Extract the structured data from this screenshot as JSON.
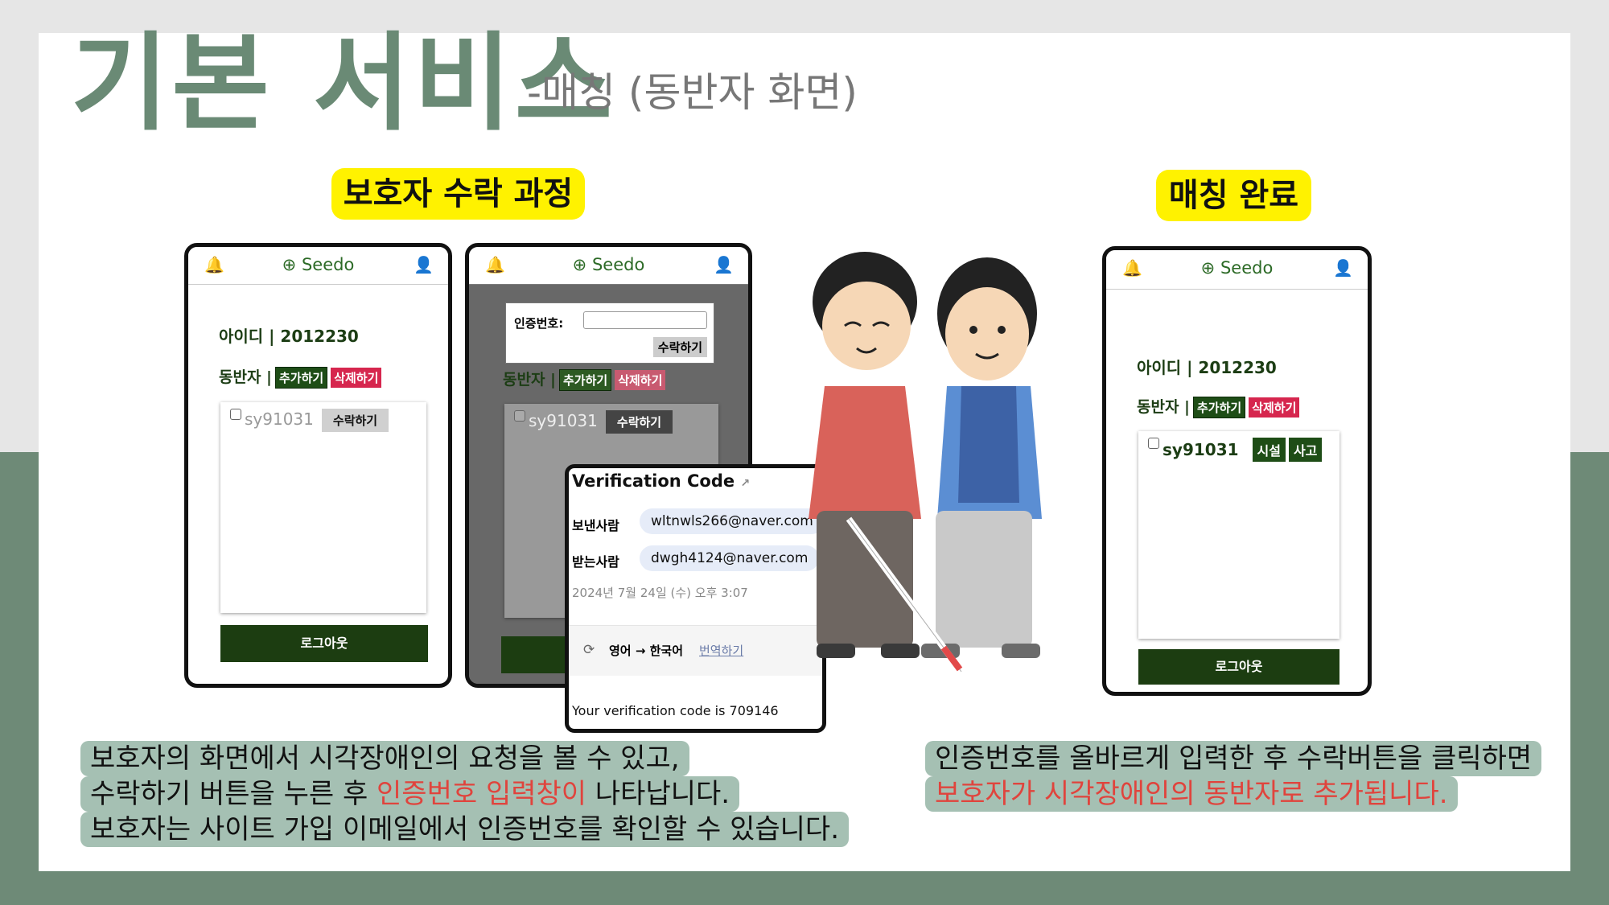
{
  "title": "기본 서비스",
  "subtitle": "-매칭 (동반자 화면)",
  "label_left": "보호자 수락 과정",
  "label_right": "매칭 완료",
  "app": {
    "brand": "Seedo",
    "user_id": "아이디 | 2012230",
    "companion_label": "동반자 |",
    "add_label": "추가하기",
    "delete_label": "삭제하기",
    "request_user": "sy91031",
    "accept_label": "수락하기",
    "logout_label": "로그아웃",
    "tag_facility": "시설",
    "tag_accident": "사고"
  },
  "modal": {
    "code_label": "인증번호:",
    "accept_label": "수락하기"
  },
  "email": {
    "subject": "Verification Code",
    "sender_label": "보낸사람",
    "sender": "wltnwls266@naver.com",
    "receiver_label": "받는사람",
    "receiver": "dwgh4124@naver.com",
    "date": "2024년 7월 24일 (수) 오후 3:07",
    "translate_lang": "영어 → 한국어",
    "translate_link": "번역하기",
    "body": "Your verification code is 709146"
  },
  "caption_left": {
    "line1": "보호자의 화면에서 시각장애인의 요청을 볼 수 있고,",
    "line2_pre": "수락하기 버튼을 누른 후 ",
    "line2_red": "인증번호 입력창이",
    "line2_post": " 나타납니다.",
    "line3": "보호자는 사이트 가입 이메일에서 인증번호를 확인할 수 있습니다."
  },
  "caption_right": {
    "line1": "인증번호를 올바르게 입력한 후 수락버튼을 클릭하면",
    "line2_red": "보호자가 시각장애인의 동반자로 추가됩니다."
  },
  "colors": {
    "accent_green": "#6a8a75",
    "dark_green": "#1c3d11",
    "caption_bg": "#a5c0b3",
    "highlight": "#fff200",
    "red": "#e0443d"
  }
}
